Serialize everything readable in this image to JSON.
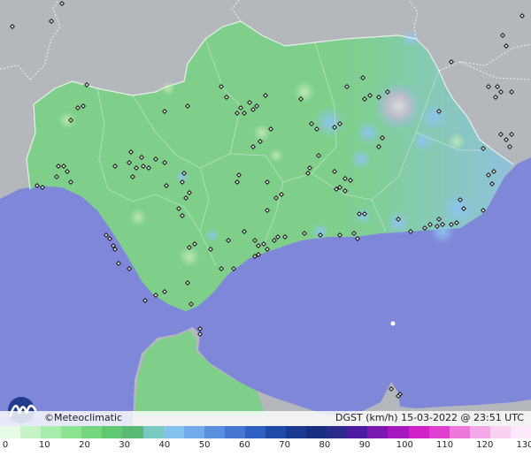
{
  "map": {
    "brand": "Meteoclimatic",
    "copyright_symbol": "©",
    "caption": "DGST (km/h)  15-03-2022 @ 23:51 UTC",
    "colors": {
      "sea": "#7f88d8",
      "land_outside": "#b4b8bd",
      "region_base": "#7fcf8a",
      "border_line": "#ffffff",
      "station_marker": "#111111"
    }
  },
  "legend": {
    "ticks": [
      "0",
      "10",
      "20",
      "30",
      "40",
      "50",
      "60",
      "70",
      "80",
      "90",
      "100",
      "110",
      "120",
      "130"
    ],
    "colors": [
      "#e6fae6",
      "#c3f3c6",
      "#a6ecab",
      "#8de394",
      "#74d67f",
      "#62c772",
      "#5ab972",
      "#78c8c4",
      "#86c2ee",
      "#72aaea",
      "#5a8fe0",
      "#4476d2",
      "#2f5fc0",
      "#1e4aa8",
      "#1a3a92",
      "#182e80",
      "#2a2a8a",
      "#4a1aa0",
      "#7a18b0",
      "#a418c0",
      "#d020c8",
      "#e040d0",
      "#ec78dc",
      "#f4a8e8",
      "#f8d0f0",
      "#fce8f8"
    ]
  }
}
